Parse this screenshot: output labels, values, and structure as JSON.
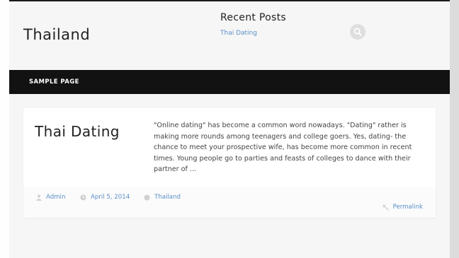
{
  "site": {
    "title": "Thailand"
  },
  "widget": {
    "title": "Recent Posts",
    "links": [
      "Thai Dating"
    ]
  },
  "nav": {
    "items": [
      "SAMPLE PAGE"
    ]
  },
  "post": {
    "title": "Thai Dating",
    "excerpt": "\"Online dating\" has become a common word nowadays. \"Dating\" rather is making more rounds among teenagers and college goers. Yes, dating- the chance to meet your prospective wife, has become more common in recent times. Young people go to parties and feasts of colleges to dance with their partner of ...",
    "author": "Admin",
    "date": "April 5, 2014",
    "category": "Thailand",
    "permalink": "Permalink"
  },
  "icons": {
    "search": "search-icon",
    "author": "user-icon",
    "date": "clock-icon",
    "category": "folder-icon",
    "permalink": "link-icon"
  },
  "colors": {
    "link": "#5b8fc7",
    "nav_bg": "#121212",
    "icon_gray": "#d0d0d0"
  }
}
